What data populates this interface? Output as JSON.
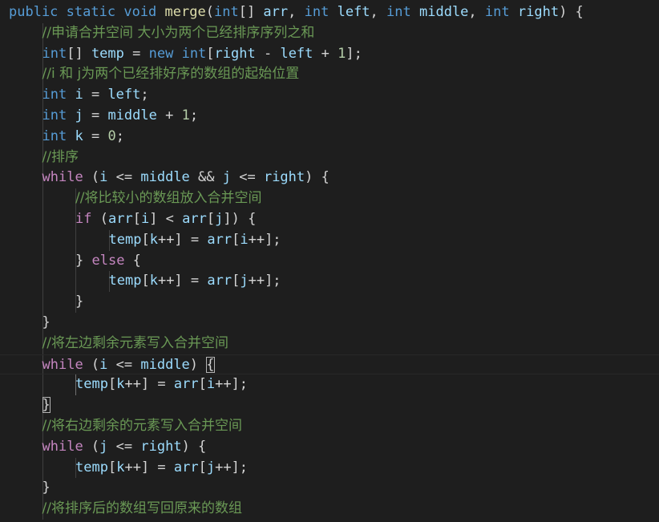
{
  "editor": {
    "lines": [
      {
        "indent": 1,
        "tokens": [
          {
            "t": "public",
            "c": "kw"
          },
          {
            "t": " ",
            "c": "pun"
          },
          {
            "t": "static",
            "c": "kw"
          },
          {
            "t": " ",
            "c": "pun"
          },
          {
            "t": "void",
            "c": "kw"
          },
          {
            "t": " ",
            "c": "pun"
          },
          {
            "t": "merge",
            "c": "fn"
          },
          {
            "t": "(",
            "c": "pun"
          },
          {
            "t": "int",
            "c": "kw"
          },
          {
            "t": "[] ",
            "c": "pun"
          },
          {
            "t": "arr",
            "c": "id"
          },
          {
            "t": ", ",
            "c": "pun"
          },
          {
            "t": "int",
            "c": "kw"
          },
          {
            "t": " ",
            "c": "pun"
          },
          {
            "t": "left",
            "c": "id"
          },
          {
            "t": ", ",
            "c": "pun"
          },
          {
            "t": "int",
            "c": "kw"
          },
          {
            "t": " ",
            "c": "pun"
          },
          {
            "t": "middle",
            "c": "id"
          },
          {
            "t": ", ",
            "c": "pun"
          },
          {
            "t": "int",
            "c": "kw"
          },
          {
            "t": " ",
            "c": "pun"
          },
          {
            "t": "right",
            "c": "id"
          },
          {
            "t": ") {",
            "c": "pun"
          }
        ]
      },
      {
        "indent": 2,
        "tokens": [
          {
            "t": "//申请合并空间 大小为两个已经排序序列之和",
            "c": "cmt"
          }
        ]
      },
      {
        "indent": 2,
        "tokens": [
          {
            "t": "int",
            "c": "kw"
          },
          {
            "t": "[] ",
            "c": "pun"
          },
          {
            "t": "temp",
            "c": "id"
          },
          {
            "t": " = ",
            "c": "pun"
          },
          {
            "t": "new",
            "c": "kw"
          },
          {
            "t": " ",
            "c": "pun"
          },
          {
            "t": "int",
            "c": "kw"
          },
          {
            "t": "[",
            "c": "pun"
          },
          {
            "t": "right",
            "c": "id"
          },
          {
            "t": " - ",
            "c": "pun"
          },
          {
            "t": "left",
            "c": "id"
          },
          {
            "t": " + ",
            "c": "pun"
          },
          {
            "t": "1",
            "c": "num"
          },
          {
            "t": "];",
            "c": "pun"
          }
        ]
      },
      {
        "indent": 2,
        "tokens": [
          {
            "t": "//i 和 j为两个已经排好序的数组的起始位置",
            "c": "cmt"
          }
        ]
      },
      {
        "indent": 2,
        "tokens": [
          {
            "t": "int",
            "c": "kw"
          },
          {
            "t": " ",
            "c": "pun"
          },
          {
            "t": "i",
            "c": "id"
          },
          {
            "t": " = ",
            "c": "pun"
          },
          {
            "t": "left",
            "c": "id"
          },
          {
            "t": ";",
            "c": "pun"
          }
        ]
      },
      {
        "indent": 2,
        "tokens": [
          {
            "t": "int",
            "c": "kw"
          },
          {
            "t": " ",
            "c": "pun"
          },
          {
            "t": "j",
            "c": "id"
          },
          {
            "t": " = ",
            "c": "pun"
          },
          {
            "t": "middle",
            "c": "id"
          },
          {
            "t": " + ",
            "c": "pun"
          },
          {
            "t": "1",
            "c": "num"
          },
          {
            "t": ";",
            "c": "pun"
          }
        ]
      },
      {
        "indent": 2,
        "tokens": [
          {
            "t": "int",
            "c": "kw"
          },
          {
            "t": " ",
            "c": "pun"
          },
          {
            "t": "k",
            "c": "id"
          },
          {
            "t": " = ",
            "c": "pun"
          },
          {
            "t": "0",
            "c": "num"
          },
          {
            "t": ";",
            "c": "pun"
          }
        ]
      },
      {
        "indent": 2,
        "tokens": [
          {
            "t": "//排序",
            "c": "cmt"
          }
        ]
      },
      {
        "indent": 2,
        "tokens": [
          {
            "t": "while",
            "c": "ctl"
          },
          {
            "t": " (",
            "c": "pun"
          },
          {
            "t": "i",
            "c": "id"
          },
          {
            "t": " <= ",
            "c": "pun"
          },
          {
            "t": "middle",
            "c": "id"
          },
          {
            "t": " && ",
            "c": "pun"
          },
          {
            "t": "j",
            "c": "id"
          },
          {
            "t": " <= ",
            "c": "pun"
          },
          {
            "t": "right",
            "c": "id"
          },
          {
            "t": ") {",
            "c": "pun"
          }
        ]
      },
      {
        "indent": 3,
        "tokens": [
          {
            "t": "//将比较小的数组放入合并空间",
            "c": "cmt"
          }
        ]
      },
      {
        "indent": 3,
        "tokens": [
          {
            "t": "if",
            "c": "ctl"
          },
          {
            "t": " (",
            "c": "pun"
          },
          {
            "t": "arr",
            "c": "id"
          },
          {
            "t": "[",
            "c": "pun"
          },
          {
            "t": "i",
            "c": "id"
          },
          {
            "t": "] < ",
            "c": "pun"
          },
          {
            "t": "arr",
            "c": "id"
          },
          {
            "t": "[",
            "c": "pun"
          },
          {
            "t": "j",
            "c": "id"
          },
          {
            "t": "]) {",
            "c": "pun"
          }
        ]
      },
      {
        "indent": 4,
        "tokens": [
          {
            "t": "temp",
            "c": "id"
          },
          {
            "t": "[",
            "c": "pun"
          },
          {
            "t": "k",
            "c": "id"
          },
          {
            "t": "++] = ",
            "c": "pun"
          },
          {
            "t": "arr",
            "c": "id"
          },
          {
            "t": "[",
            "c": "pun"
          },
          {
            "t": "i",
            "c": "id"
          },
          {
            "t": "++];",
            "c": "pun"
          }
        ]
      },
      {
        "indent": 3,
        "tokens": [
          {
            "t": "} ",
            "c": "pun"
          },
          {
            "t": "else",
            "c": "ctl"
          },
          {
            "t": " {",
            "c": "pun"
          }
        ]
      },
      {
        "indent": 4,
        "tokens": [
          {
            "t": "temp",
            "c": "id"
          },
          {
            "t": "[",
            "c": "pun"
          },
          {
            "t": "k",
            "c": "id"
          },
          {
            "t": "++] = ",
            "c": "pun"
          },
          {
            "t": "arr",
            "c": "id"
          },
          {
            "t": "[",
            "c": "pun"
          },
          {
            "t": "j",
            "c": "id"
          },
          {
            "t": "++];",
            "c": "pun"
          }
        ]
      },
      {
        "indent": 3,
        "tokens": [
          {
            "t": "}",
            "c": "pun"
          }
        ]
      },
      {
        "indent": 2,
        "tokens": [
          {
            "t": "}",
            "c": "pun"
          }
        ]
      },
      {
        "indent": 2,
        "tokens": [
          {
            "t": "//将左边剩余元素写入合并空间",
            "c": "cmt"
          }
        ]
      },
      {
        "indent": 2,
        "current": true,
        "tokens": [
          {
            "t": "while",
            "c": "ctl"
          },
          {
            "t": " (",
            "c": "pun"
          },
          {
            "t": "i",
            "c": "id"
          },
          {
            "t": " <= ",
            "c": "pun"
          },
          {
            "t": "middle",
            "c": "id"
          },
          {
            "t": ") ",
            "c": "pun"
          },
          {
            "t": "{",
            "c": "pun",
            "match": true
          }
        ]
      },
      {
        "indent": 3,
        "tokens": [
          {
            "t": "temp",
            "c": "id"
          },
          {
            "t": "[",
            "c": "pun"
          },
          {
            "t": "k",
            "c": "id"
          },
          {
            "t": "++] = ",
            "c": "pun"
          },
          {
            "t": "arr",
            "c": "id"
          },
          {
            "t": "[",
            "c": "pun"
          },
          {
            "t": "i",
            "c": "id"
          },
          {
            "t": "++];",
            "c": "pun"
          }
        ]
      },
      {
        "indent": 2,
        "tokens": [
          {
            "t": "}",
            "c": "pun",
            "match": true
          }
        ]
      },
      {
        "indent": 2,
        "tokens": [
          {
            "t": "//将右边剩余的元素写入合并空间",
            "c": "cmt"
          }
        ]
      },
      {
        "indent": 2,
        "tokens": [
          {
            "t": "while",
            "c": "ctl"
          },
          {
            "t": " (",
            "c": "pun"
          },
          {
            "t": "j",
            "c": "id"
          },
          {
            "t": " <= ",
            "c": "pun"
          },
          {
            "t": "right",
            "c": "id"
          },
          {
            "t": ") {",
            "c": "pun"
          }
        ]
      },
      {
        "indent": 3,
        "tokens": [
          {
            "t": "temp",
            "c": "id"
          },
          {
            "t": "[",
            "c": "pun"
          },
          {
            "t": "k",
            "c": "id"
          },
          {
            "t": "++] = ",
            "c": "pun"
          },
          {
            "t": "arr",
            "c": "id"
          },
          {
            "t": "[",
            "c": "pun"
          },
          {
            "t": "j",
            "c": "id"
          },
          {
            "t": "++];",
            "c": "pun"
          }
        ]
      },
      {
        "indent": 2,
        "tokens": [
          {
            "t": "}",
            "c": "pun"
          }
        ]
      },
      {
        "indent": 2,
        "tokens": [
          {
            "t": "//将排序后的数组写回原来的数组",
            "c": "cmt"
          }
        ]
      }
    ]
  },
  "colors": {
    "background": "#1e1e1e",
    "keyword": "#569cd6",
    "control": "#c586c0",
    "function": "#dcdcaa",
    "identifier": "#9cdcfe",
    "number": "#b5cea8",
    "comment": "#6a9955",
    "punctuation": "#d4d4d4"
  }
}
